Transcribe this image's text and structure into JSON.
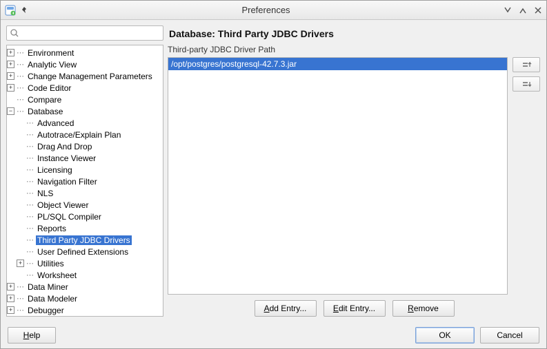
{
  "window": {
    "title": "Preferences"
  },
  "search": {
    "placeholder": ""
  },
  "icons": {
    "app": "app-icon",
    "pin": "pin-icon",
    "minimize": "minimize-icon",
    "maximize": "maximize-icon",
    "close": "close-icon",
    "search": "search-icon",
    "moveup": "move-up-icon",
    "movedown": "move-down-icon"
  },
  "tree": [
    {
      "label": "Environment",
      "depth": 0,
      "exp": "plus",
      "selected": false
    },
    {
      "label": "Analytic View",
      "depth": 0,
      "exp": "plus",
      "selected": false
    },
    {
      "label": "Change Management Parameters",
      "depth": 0,
      "exp": "plus",
      "selected": false
    },
    {
      "label": "Code Editor",
      "depth": 0,
      "exp": "plus",
      "selected": false
    },
    {
      "label": "Compare",
      "depth": 0,
      "exp": "none",
      "selected": false
    },
    {
      "label": "Database",
      "depth": 0,
      "exp": "minus",
      "selected": false
    },
    {
      "label": "Advanced",
      "depth": 1,
      "exp": "none",
      "selected": false
    },
    {
      "label": "Autotrace/Explain Plan",
      "depth": 1,
      "exp": "none",
      "selected": false
    },
    {
      "label": "Drag And Drop",
      "depth": 1,
      "exp": "none",
      "selected": false
    },
    {
      "label": "Instance Viewer",
      "depth": 1,
      "exp": "none",
      "selected": false
    },
    {
      "label": "Licensing",
      "depth": 1,
      "exp": "none",
      "selected": false
    },
    {
      "label": "Navigation Filter",
      "depth": 1,
      "exp": "none",
      "selected": false
    },
    {
      "label": "NLS",
      "depth": 1,
      "exp": "none",
      "selected": false
    },
    {
      "label": "Object Viewer",
      "depth": 1,
      "exp": "none",
      "selected": false
    },
    {
      "label": "PL/SQL Compiler",
      "depth": 1,
      "exp": "none",
      "selected": false
    },
    {
      "label": "Reports",
      "depth": 1,
      "exp": "none",
      "selected": false
    },
    {
      "label": "Third Party JDBC Drivers",
      "depth": 1,
      "exp": "none",
      "selected": true
    },
    {
      "label": "User Defined Extensions",
      "depth": 1,
      "exp": "none",
      "selected": false
    },
    {
      "label": "Utilities",
      "depth": 1,
      "exp": "plus",
      "selected": false
    },
    {
      "label": "Worksheet",
      "depth": 1,
      "exp": "none",
      "selected": false
    },
    {
      "label": "Data Miner",
      "depth": 0,
      "exp": "plus",
      "selected": false
    },
    {
      "label": "Data Modeler",
      "depth": 0,
      "exp": "plus",
      "selected": false
    },
    {
      "label": "Debugger",
      "depth": 0,
      "exp": "plus",
      "selected": false
    }
  ],
  "panel": {
    "heading": "Database: Third Party JDBC Drivers",
    "list_label": "Third-party JDBC Driver Path",
    "entries": [
      {
        "path": "/opt/postgres/postgresql-42.7.3.jar",
        "selected": true
      }
    ],
    "buttons": {
      "add": "Add Entry...",
      "edit": "Edit Entry...",
      "remove": "Remove"
    }
  },
  "footer": {
    "help": "Help",
    "ok": "OK",
    "cancel": "Cancel"
  }
}
